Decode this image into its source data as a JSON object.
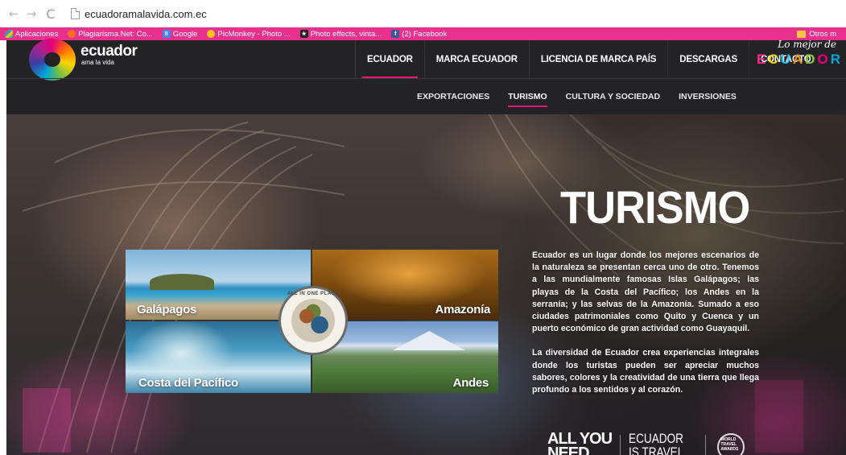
{
  "browser": {
    "url": "ecuadoramalavida.com.ec",
    "nav": {
      "back": "←",
      "forward": "→",
      "reload": "C"
    }
  },
  "bookmarks": {
    "items": [
      {
        "label": "Aplicaciones",
        "icon": "apps-icon"
      },
      {
        "label": "Plagiarisma.Net: Co...",
        "icon": "plagiarisma-icon"
      },
      {
        "label": "Google",
        "icon": "google-icon",
        "glyph": "8"
      },
      {
        "label": "PicMonkey - Photo ...",
        "icon": "picmonkey-icon"
      },
      {
        "label": "Photo effects, vinta...",
        "icon": "photo-effects-icon"
      },
      {
        "label": "(2) Facebook",
        "icon": "facebook-icon",
        "glyph": "f"
      }
    ],
    "other": "Otros m"
  },
  "site": {
    "logo": {
      "word": "ecuador",
      "sub": "ama la vida"
    },
    "main_nav": [
      "ECUADOR",
      "MARCA ECUADOR",
      "LICENCIA DE MARCA PAÍS",
      "DESCARGAS",
      "CONTACTO"
    ],
    "brand": {
      "script": "Lo mejor de",
      "word": [
        "E",
        "C",
        "U",
        "A",
        "D",
        "O",
        "R"
      ]
    },
    "sub_nav": [
      "EXPORTACIONES",
      "TURISMO",
      "CULTURA Y SOCIEDAD",
      "INVERSIONES"
    ]
  },
  "hero": {
    "title": "TURISMO",
    "paragraphs": [
      "Ecuador es un lugar donde los mejores escenarios de la naturaleza se presentan cerca uno de otro. Tenemos a las mundialmente famosas Islas Galápagos; las playas de la Costa del Pacífico; los Andes en la serranía; y las selvas de la Amazonía. Sumado a eso ciudades patrimoniales como Quito y Cuenca y un puerto económico de gran actividad como Guayaquil.",
      "La diversidad de Ecuador crea experiencias integrales donde los turistas pueden ser apreciar muchos sabores, colores y la creatividad de una tierra que llega profundo a los sentidos y al corazón."
    ],
    "collage": {
      "tiles": [
        "Galápagos",
        "Amazonía",
        "Costa del Pacífico",
        "Andes"
      ],
      "seal_text": "ALL IN ONE PLACE"
    },
    "badges": {
      "ayn": "ALL YOU",
      "ayn2": "NEED",
      "ecuador": "ECUADOR",
      "ecuador2": "IS TRAVEL",
      "wta": "WORLD TRAVEL AWARDS"
    }
  },
  "colors": {
    "accent": "#e6197a",
    "bookmark_bar": "#e8318c",
    "header_bg": "#232325"
  }
}
